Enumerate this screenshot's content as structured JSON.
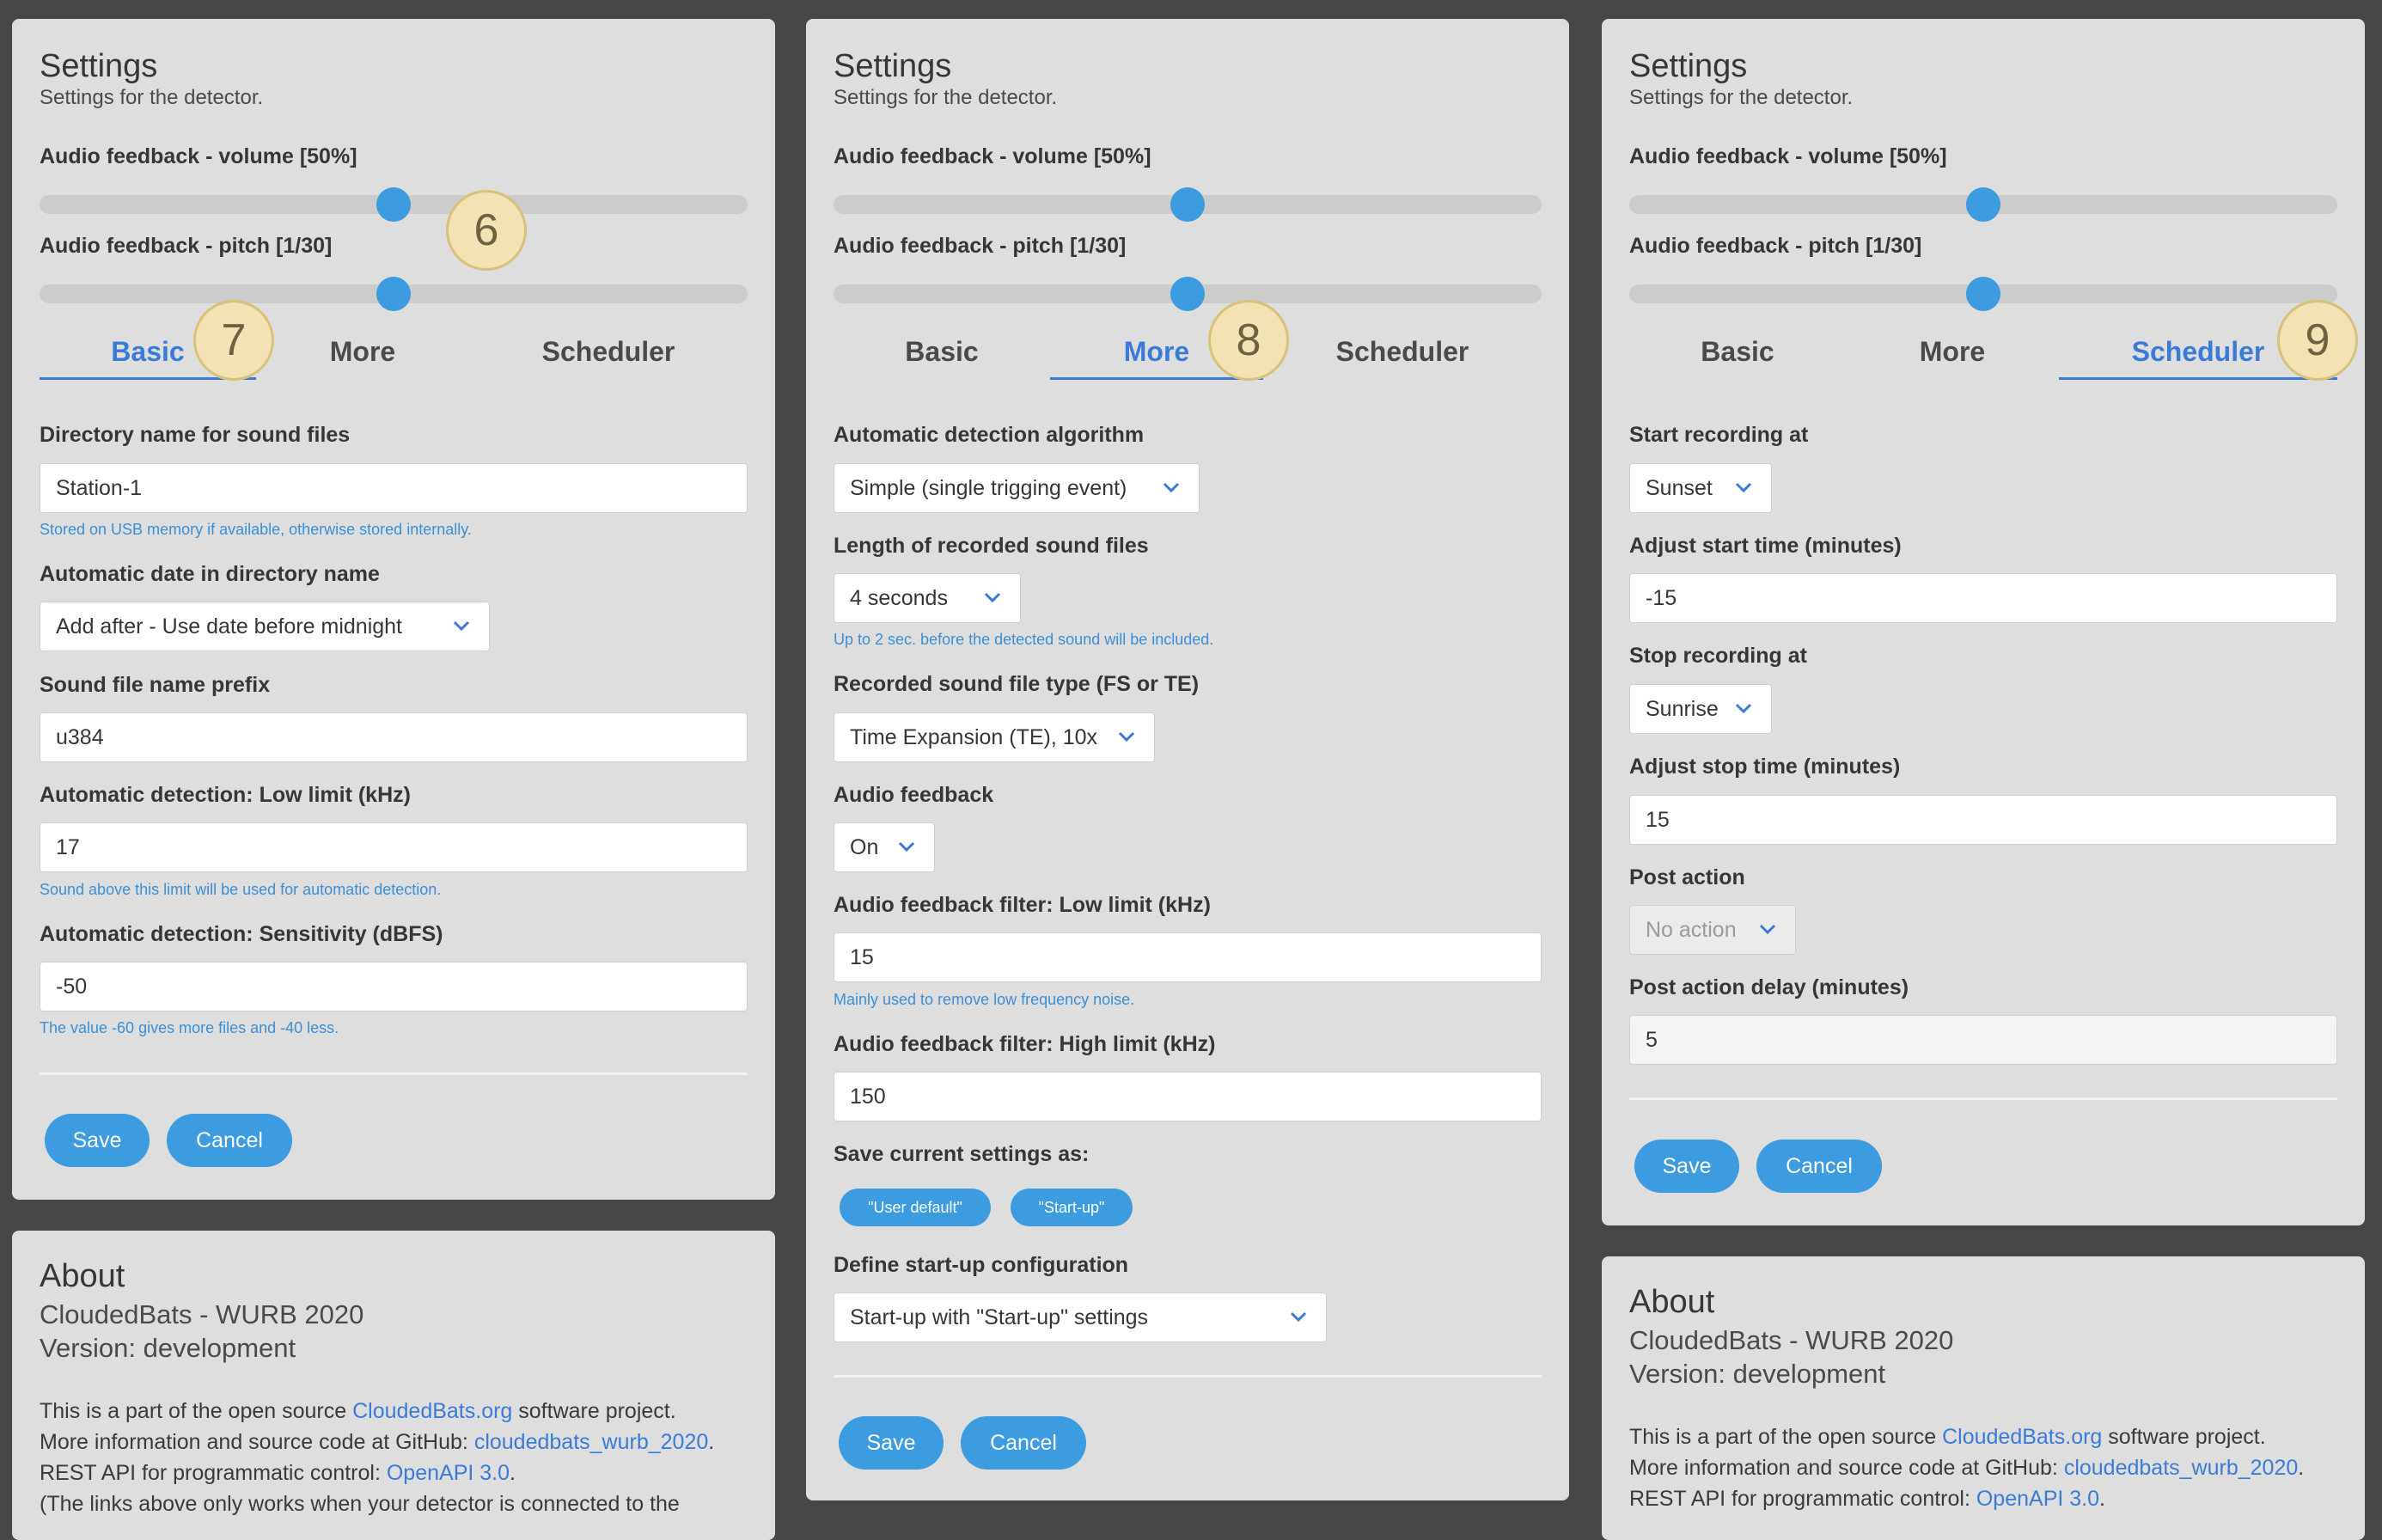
{
  "panels": [
    {
      "settings": {
        "title": "Settings",
        "subtitle": "Settings for the detector.",
        "volume_label": "Audio feedback - volume  [50%]",
        "volume_value": 0.5,
        "pitch_label": "Audio feedback - pitch  [1/30]",
        "pitch_value": 0.5
      },
      "tabs": [
        "Basic",
        "More",
        "Scheduler"
      ],
      "active_tab": "Basic",
      "badges": [
        "6",
        "7"
      ],
      "fields": {
        "dir_label": "Directory name for sound files",
        "dir_value": "Station-1",
        "dir_help": "Stored on USB memory if available, otherwise stored internally.",
        "date_label": "Automatic date in directory name",
        "date_value": "Add after - Use date before midnight",
        "prefix_label": "Sound file name prefix",
        "prefix_value": "u384",
        "low_label": "Automatic detection: Low limit (kHz)",
        "low_value": "17",
        "low_help": "Sound above this limit will be used for automatic detection.",
        "sens_label": "Automatic detection: Sensitivity (dBFS)",
        "sens_value": "-50",
        "sens_help": "The value -60 gives more files and -40 less."
      },
      "save_label": "Save",
      "cancel_label": "Cancel",
      "about": {
        "title": "About",
        "line1": "CloudedBats - WURB 2020",
        "line2": "Version: development",
        "p1_pre": "This is a part of the open source ",
        "p1_link": "CloudedBats.org",
        "p1_post": " software project.",
        "p2_pre": "More information and source code at GitHub: ",
        "p2_link": "cloudedbats_wurb_2020",
        "p2_post": ".",
        "p3_pre": "REST API for programmatic control: ",
        "p3_link": "OpenAPI 3.0",
        "p3_post": ".",
        "p4": "(The links above only works when your detector is connected to the"
      }
    },
    {
      "settings": {
        "title": "Settings",
        "subtitle": "Settings for the detector.",
        "volume_label": "Audio feedback - volume  [50%]",
        "volume_value": 0.5,
        "pitch_label": "Audio feedback - pitch  [1/30]",
        "pitch_value": 0.5
      },
      "tabs": [
        "Basic",
        "More",
        "Scheduler"
      ],
      "active_tab": "More",
      "badges": [
        "8"
      ],
      "fields": {
        "algo_label": "Automatic detection algorithm",
        "algo_value": "Simple (single trigging event)",
        "length_label": "Length of recorded sound files",
        "length_value": "4 seconds",
        "length_help": "Up to 2 sec. before the detected sound will be included.",
        "type_label": "Recorded sound file type (FS or TE)",
        "type_value": "Time Expansion (TE), 10x",
        "feedback_label": "Audio feedback",
        "feedback_value": "On",
        "flow_label": "Audio feedback filter: Low limit (kHz)",
        "flow_value": "15",
        "flow_help": "Mainly used to remove low frequency noise.",
        "fhigh_label": "Audio feedback filter: High limit (kHz)",
        "fhigh_value": "150",
        "saveas_label": "Save current settings as:",
        "pill_user": "\"User default\"",
        "pill_startup": "\"Start-up\"",
        "startup_label": "Define start-up configuration",
        "startup_value": "Start-up with \"Start-up\" settings"
      },
      "save_label": "Save",
      "cancel_label": "Cancel"
    },
    {
      "settings": {
        "title": "Settings",
        "subtitle": "Settings for the detector.",
        "volume_label": "Audio feedback - volume  [50%]",
        "volume_value": 0.5,
        "pitch_label": "Audio feedback - pitch  [1/30]",
        "pitch_value": 0.5
      },
      "tabs": [
        "Basic",
        "More",
        "Scheduler"
      ],
      "active_tab": "Scheduler",
      "badges": [
        "9"
      ],
      "fields": {
        "start_label": "Start recording at",
        "start_value": "Sunset",
        "adjstart_label": "Adjust start time (minutes)",
        "adjstart_value": "-15",
        "stop_label": "Stop recording at",
        "stop_value": "Sunrise",
        "adjstop_label": "Adjust stop time (minutes)",
        "adjstop_value": "15",
        "post_label": "Post action",
        "post_value": "No action",
        "delay_label": "Post action delay (minutes)",
        "delay_value": "5"
      },
      "save_label": "Save",
      "cancel_label": "Cancel",
      "about": {
        "title": "About",
        "line1": "CloudedBats - WURB 2020",
        "line2": "Version: development",
        "p1_pre": "This is a part of the open source ",
        "p1_link": "CloudedBats.org",
        "p1_post": " software project.",
        "p2_pre": "More information and source code at GitHub: ",
        "p2_link": "cloudedbats_wurb_2020",
        "p2_post": ".",
        "p3_pre": "REST API for programmatic control: ",
        "p3_link": "OpenAPI 3.0",
        "p3_post": "."
      }
    }
  ],
  "colors": {
    "accent": "#3d9be0",
    "tab_active": "#3b7bd8",
    "badge": "#f3e2b3",
    "background": "#474747",
    "card": "#dedede"
  },
  "icons": {
    "select_chevron": "chevron-down-icon"
  }
}
